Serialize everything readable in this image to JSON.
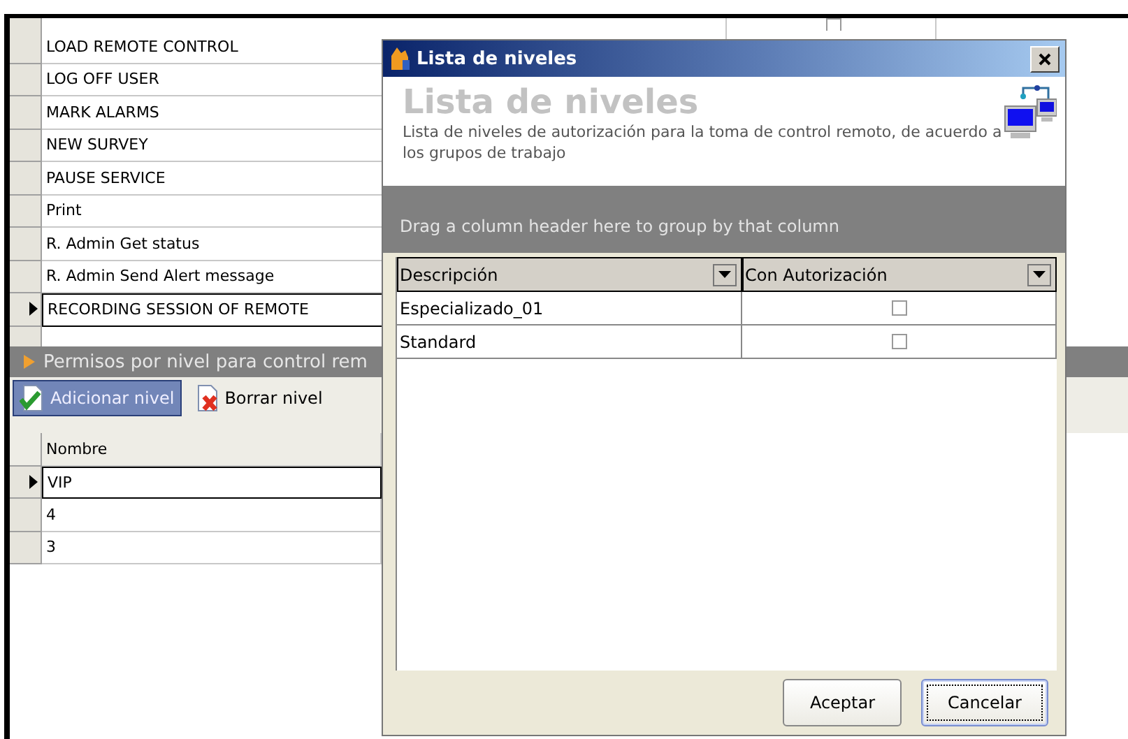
{
  "main_grid": {
    "rows": [
      {
        "current": false,
        "checked": false
      },
      {
        "name": "LOAD REMOTE CONTROL",
        "current": false
      },
      {
        "name": "LOG OFF USER",
        "current": false
      },
      {
        "name": "MARK ALARMS",
        "current": false
      },
      {
        "name": "NEW SURVEY",
        "current": false
      },
      {
        "name": "PAUSE SERVICE",
        "current": false
      },
      {
        "name": "Print",
        "current": false
      },
      {
        "name": "R. Admin Get status",
        "current": false
      },
      {
        "name": "R. Admin Send Alert message",
        "current": false
      },
      {
        "name": "RECORDING SESSION OF REMOTE",
        "current": true
      },
      {
        "current": false
      }
    ]
  },
  "levels_panel": {
    "title": "Permisos por nivel para control rem",
    "toolbar": [
      {
        "label": "Adicionar nivel",
        "kind": "add",
        "selected": true
      },
      {
        "label": "Borrar nivel",
        "kind": "delete",
        "selected": false
      }
    ],
    "columns": [
      "Nombre"
    ],
    "rows": [
      {
        "name": "VIP",
        "current": true
      },
      {
        "name": "4",
        "current": false
      },
      {
        "name": "3",
        "current": false
      }
    ]
  },
  "dialog": {
    "title": "Lista de niveles",
    "heading": "Lista de niveles",
    "description": "Lista de niveles de autorización para la toma de control remoto, de acuerdo a los grupos de trabajo",
    "group_hint": "Drag a column header here to group by that column",
    "columns": [
      "Descripción",
      "Con Autorización"
    ],
    "rows": [
      {
        "description": "Especializado_01",
        "authorized": false
      },
      {
        "description": "Standard",
        "authorized": false
      }
    ],
    "buttons": [
      {
        "label": "Aceptar",
        "focused": false
      },
      {
        "label": "Cancelar",
        "focused": true
      }
    ]
  }
}
